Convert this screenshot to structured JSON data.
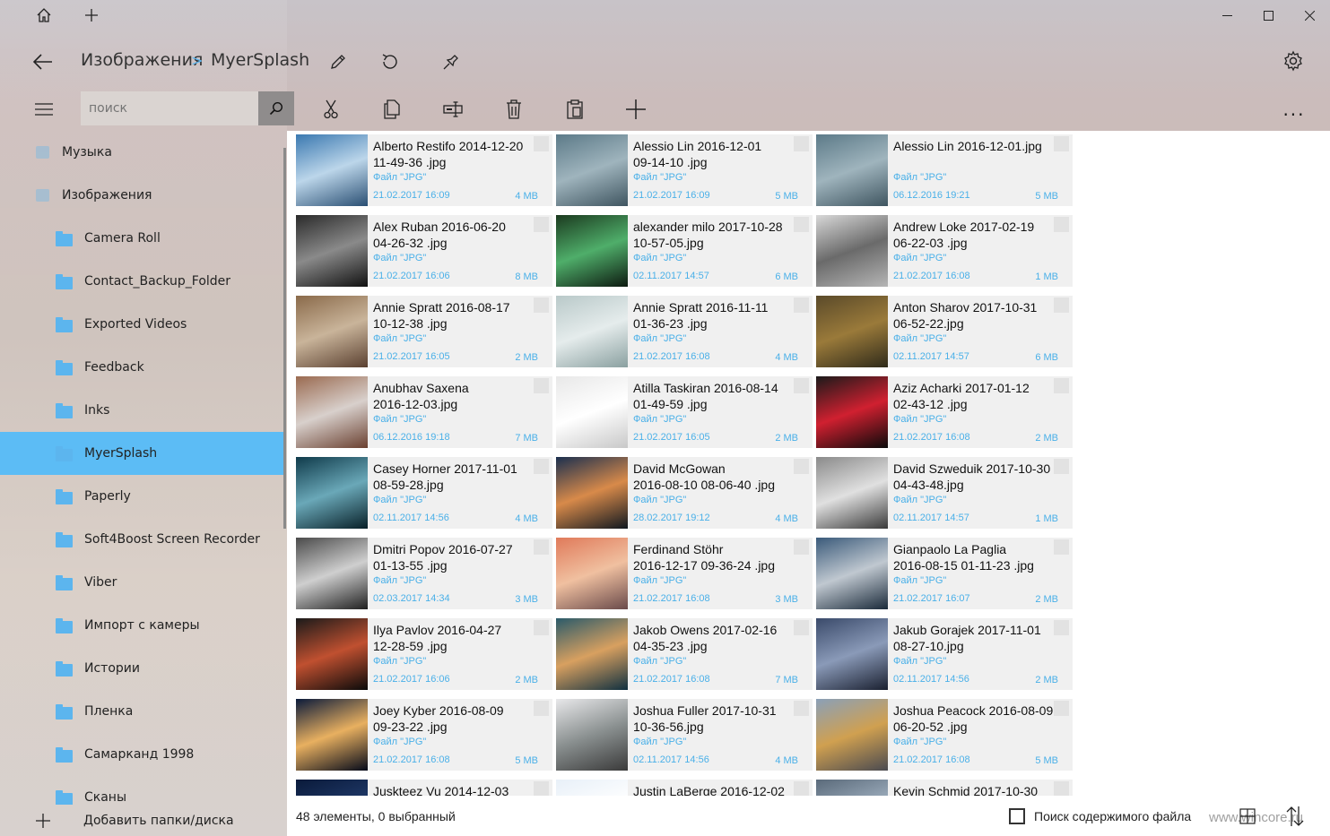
{
  "titlebar": {
    "home_icon": "home-icon",
    "newtab_icon": "plus-icon",
    "window_controls": [
      "minimize",
      "maximize",
      "close"
    ]
  },
  "nav": {
    "breadcrumb": [
      "Изображения",
      "MyerSplash"
    ],
    "breadcrumb_separator": ">",
    "separator_color": "#5cb5ee"
  },
  "search": {
    "placeholder": "поиск"
  },
  "toolbar": {
    "actions": [
      "cut",
      "copy",
      "rename",
      "delete",
      "paste",
      "new"
    ],
    "more": "..."
  },
  "sidebar": {
    "items": [
      {
        "label": "Музыка",
        "icon": "music-icon",
        "level": 0
      },
      {
        "label": "Изображения",
        "icon": "pictures-icon",
        "level": 0
      },
      {
        "label": "Camera Roll",
        "icon": "folder-icon",
        "level": 1
      },
      {
        "label": "Contact_Backup_Folder",
        "icon": "folder-icon",
        "level": 1
      },
      {
        "label": "Exported Videos",
        "icon": "folder-icon",
        "level": 1
      },
      {
        "label": "Feedback",
        "icon": "folder-icon",
        "level": 1
      },
      {
        "label": "Inks",
        "icon": "folder-icon",
        "level": 1
      },
      {
        "label": "MyerSplash",
        "icon": "folder-icon",
        "level": 1,
        "selected": true
      },
      {
        "label": "Paperly",
        "icon": "folder-icon",
        "level": 1
      },
      {
        "label": "Soft4Boost Screen Recorder",
        "icon": "folder-icon",
        "level": 1
      },
      {
        "label": "Viber",
        "icon": "folder-icon",
        "level": 1
      },
      {
        "label": "Импорт с камеры",
        "icon": "folder-icon",
        "level": 1
      },
      {
        "label": "Истории",
        "icon": "folder-icon",
        "level": 1
      },
      {
        "label": "Пленка",
        "icon": "folder-icon",
        "level": 1
      },
      {
        "label": "Самарканд 1998",
        "icon": "folder-icon",
        "level": 1
      },
      {
        "label": "Сканы",
        "icon": "folder-icon",
        "level": 1
      }
    ],
    "add_label": "Добавить папки/диска"
  },
  "files": [
    {
      "name1": "Alberto Restifo  2014-12-20",
      "name2": "11-49-36 .jpg",
      "type": "Файл \"JPG\"",
      "date": "21.02.2017 16:09",
      "size": "4 MB",
      "thumb": [
        "#3a78b0",
        "#bcd6ea",
        "#2a4f73"
      ]
    },
    {
      "name1": "Alessio Lin  2016-12-01",
      "name2": "09-14-10 .jpg",
      "type": "Файл \"JPG\"",
      "date": "21.02.2017 16:09",
      "size": "5 MB",
      "thumb": [
        "#5c7a88",
        "#9fb4bd",
        "#3f5560"
      ]
    },
    {
      "name1": "Alessio Lin  2016-12-01.jpg",
      "name2": "",
      "type": "Файл \"JPG\"",
      "date": "06.12.2016 19:21",
      "size": "5 MB",
      "thumb": [
        "#5c7a88",
        "#9fb4bd",
        "#3f5560"
      ]
    },
    {
      "name1": "Alex Ruban  2016-06-20",
      "name2": "04-26-32 .jpg",
      "type": "Файл \"JPG\"",
      "date": "21.02.2017 16:06",
      "size": "8 MB",
      "thumb": [
        "#2a2a2a",
        "#8a8a8a",
        "#111111"
      ]
    },
    {
      "name1": "alexander milo  2017-10-28",
      "name2": "10-57-05.jpg",
      "type": "Файл \"JPG\"",
      "date": "02.11.2017 14:57",
      "size": "6 MB",
      "thumb": [
        "#1b3a1f",
        "#4fae6a",
        "#0d1a10"
      ]
    },
    {
      "name1": "Andrew Loke  2017-02-19",
      "name2": "06-22-03 .jpg",
      "type": "Файл \"JPG\"",
      "date": "21.02.2017 16:08",
      "size": "1 MB",
      "thumb": [
        "#d8d8d8",
        "#6a6a6a",
        "#b5b5b5"
      ]
    },
    {
      "name1": "Annie Spratt  2016-08-17",
      "name2": "10-12-38 .jpg",
      "type": "Файл \"JPG\"",
      "date": "21.02.2017 16:05",
      "size": "2 MB",
      "thumb": [
        "#8a6a4a",
        "#c9b49a",
        "#5a4030"
      ]
    },
    {
      "name1": "Annie Spratt  2016-11-11",
      "name2": "01-36-23 .jpg",
      "type": "Файл \"JPG\"",
      "date": "21.02.2017 16:08",
      "size": "4 MB",
      "thumb": [
        "#b9c9c9",
        "#e5ecec",
        "#8aa0a0"
      ]
    },
    {
      "name1": "Anton Sharov  2017-10-31",
      "name2": "06-52-22.jpg",
      "type": "Файл \"JPG\"",
      "date": "02.11.2017 14:57",
      "size": "6 MB",
      "thumb": [
        "#5a4a2a",
        "#9a7a3a",
        "#2f2a1a"
      ]
    },
    {
      "name1": "Anubhav Saxena",
      "name2": "2016-12-03.jpg",
      "type": "Файл \"JPG\"",
      "date": "06.12.2016 19:18",
      "size": "7 MB",
      "thumb": [
        "#9a6a50",
        "#d8d0cc",
        "#6a4030"
      ]
    },
    {
      "name1": "Atilla Taskiran  2016-08-14",
      "name2": "01-49-59 .jpg",
      "type": "Файл \"JPG\"",
      "date": "21.02.2017 16:05",
      "size": "2 MB",
      "thumb": [
        "#e8e8e8",
        "#ffffff",
        "#c8c8c8"
      ]
    },
    {
      "name1": "Aziz Acharki  2017-01-12",
      "name2": "02-43-12 .jpg",
      "type": "Файл \"JPG\"",
      "date": "21.02.2017 16:08",
      "size": "2 MB",
      "thumb": [
        "#1a1a1a",
        "#d02030",
        "#0a0a0a"
      ]
    },
    {
      "name1": "Casey Horner  2017-11-01",
      "name2": "08-59-28.jpg",
      "type": "Файл \"JPG\"",
      "date": "02.11.2017 14:56",
      "size": "4 MB",
      "thumb": [
        "#0f3a4a",
        "#6aa8b8",
        "#082028"
      ]
    },
    {
      "name1": "David McGowan",
      "name2": "2016-08-10 08-06-40 .jpg",
      "type": "Файл \"JPG\"",
      "date": "28.02.2017 19:12",
      "size": "4 MB",
      "thumb": [
        "#1a2f4f",
        "#d88a4a",
        "#101820"
      ]
    },
    {
      "name1": "David Szweduik  2017-10-30",
      "name2": "04-43-48.jpg",
      "type": "Файл \"JPG\"",
      "date": "02.11.2017 14:57",
      "size": "1 MB",
      "thumb": [
        "#8a8a8a",
        "#e0e0e0",
        "#3a3a3a"
      ]
    },
    {
      "name1": "Dmitri  Popov  2016-07-27",
      "name2": "01-13-55 .jpg",
      "type": "Файл \"JPG\"",
      "date": "02.03.2017 14:34",
      "size": "3 MB",
      "thumb": [
        "#4a4a4a",
        "#cfcfcf",
        "#202020"
      ]
    },
    {
      "name1": "Ferdinand Stöhr",
      "name2": "2016-12-17 09-36-24 .jpg",
      "type": "Файл \"JPG\"",
      "date": "21.02.2017 16:08",
      "size": "3 MB",
      "thumb": [
        "#e07a5a",
        "#f0c0a0",
        "#6a4a4a"
      ]
    },
    {
      "name1": "Gianpaolo La Paglia",
      "name2": "2016-08-15 01-11-23 .jpg",
      "type": "Файл \"JPG\"",
      "date": "21.02.2017 16:07",
      "size": "2 MB",
      "thumb": [
        "#3a5a7a",
        "#c0c8d0",
        "#1a2a3a"
      ]
    },
    {
      "name1": "Ilya Pavlov  2016-04-27",
      "name2": "12-28-59 .jpg",
      "type": "Файл \"JPG\"",
      "date": "21.02.2017 16:06",
      "size": "2 MB",
      "thumb": [
        "#1a1a1a",
        "#c05030",
        "#0a0a0a"
      ]
    },
    {
      "name1": "Jakob Owens  2017-02-16",
      "name2": "04-35-23 .jpg",
      "type": "Файл \"JPG\"",
      "date": "21.02.2017 16:08",
      "size": "7 MB",
      "thumb": [
        "#2a5a6a",
        "#d8a060",
        "#103040"
      ]
    },
    {
      "name1": "Jakub Gorajek  2017-11-01",
      "name2": "08-27-10.jpg",
      "type": "Файл \"JPG\"",
      "date": "02.11.2017 14:56",
      "size": "2 MB",
      "thumb": [
        "#3a4a6a",
        "#8a9ab8",
        "#1a2030"
      ]
    },
    {
      "name1": "Joey Kyber  2016-08-09",
      "name2": "09-23-22 .jpg",
      "type": "Файл \"JPG\"",
      "date": "21.02.2017 16:08",
      "size": "5 MB",
      "thumb": [
        "#0a1a3a",
        "#e8b060",
        "#050a1a"
      ]
    },
    {
      "name1": "Joshua Fuller  2017-10-31",
      "name2": "10-36-56.jpg",
      "type": "Файл \"JPG\"",
      "date": "02.11.2017 14:56",
      "size": "4 MB",
      "thumb": [
        "#e8e8ea",
        "#8a9090",
        "#3a3a3a"
      ]
    },
    {
      "name1": "Joshua Peacock  2016-08-09",
      "name2": "06-20-52 .jpg",
      "type": "Файл \"JPG\"",
      "date": "21.02.2017 16:08",
      "size": "5 MB",
      "thumb": [
        "#8aa0b8",
        "#d0a050",
        "#4a4a50"
      ]
    },
    {
      "name1": "Juskteez Vu  2014-12-03",
      "name2": "",
      "type": "",
      "date": "",
      "size": "",
      "thumb": [
        "#0a1a3a",
        "#203a6a",
        "#050a1a"
      ]
    },
    {
      "name1": "Justin LaBerge  2016-12-02",
      "name2": "",
      "type": "",
      "date": "",
      "size": "",
      "thumb": [
        "#e8f0f8",
        "#ffffff",
        "#c0d0e0"
      ]
    },
    {
      "name1": "Kevin Schmid  2017-10-30",
      "name2": "",
      "type": "",
      "date": "",
      "size": "",
      "thumb": [
        "#5a6a7a",
        "#a0b0c0",
        "#2a3a4a"
      ]
    }
  ],
  "status": {
    "count_text": "48 элементы, 0 выбранный",
    "search_content_label": "Поиск содержимого файла",
    "watermark": "www.wincore.ru"
  }
}
